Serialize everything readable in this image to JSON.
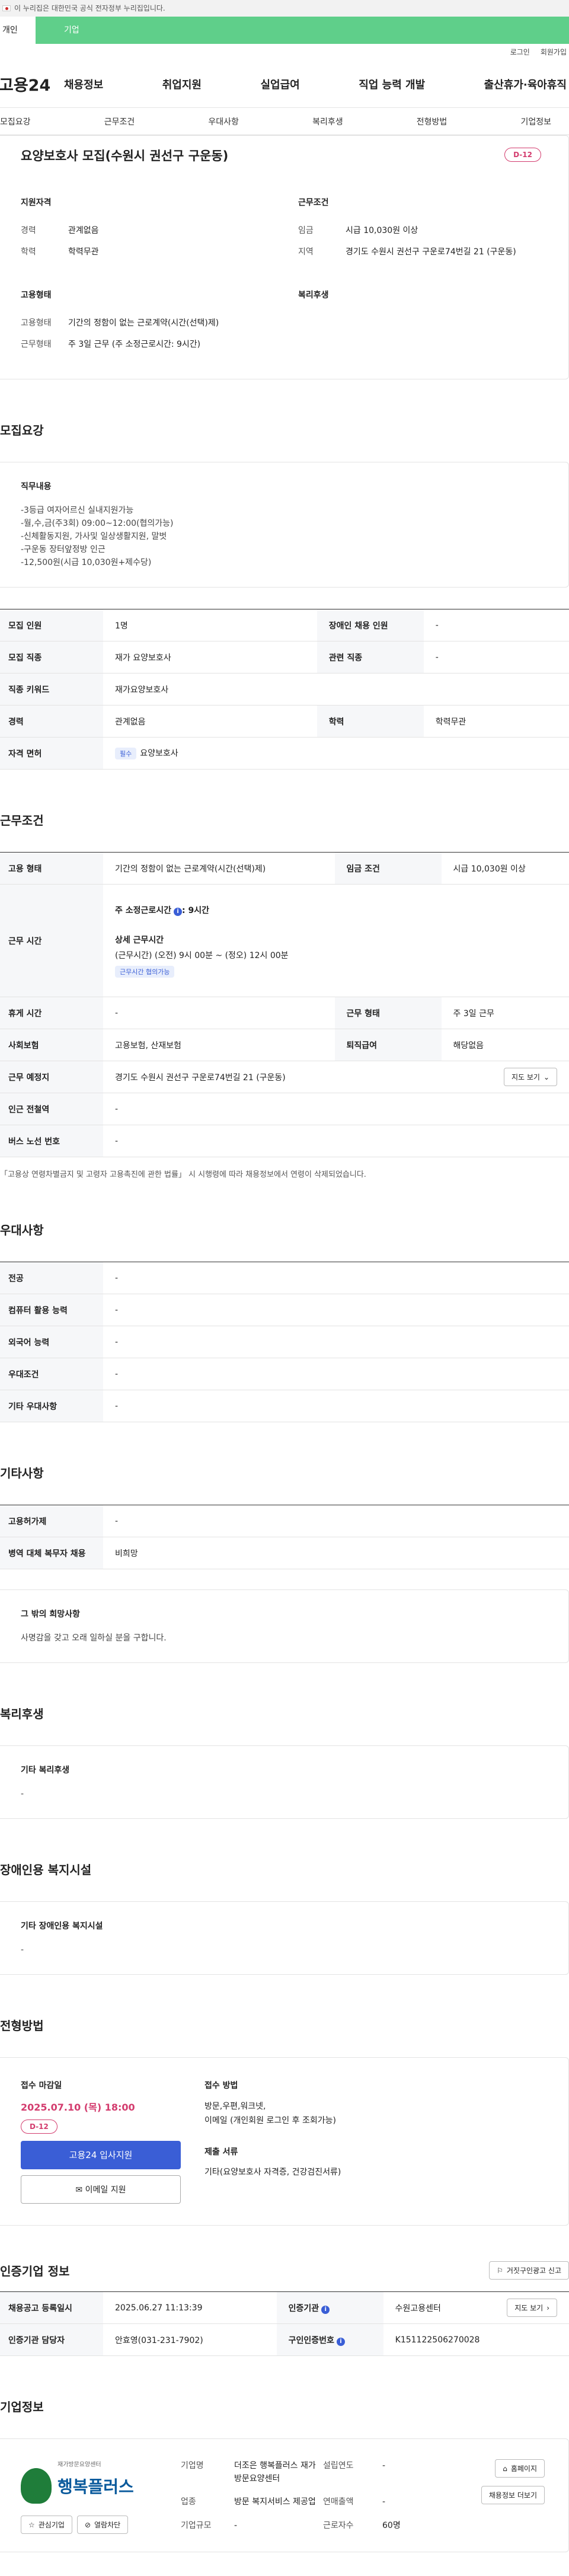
{
  "banner": {
    "text": "이 누리집은 대한민국 공식 전자정부 누리집입니다."
  },
  "user_tabs": [
    "개인",
    "기업"
  ],
  "util": [
    "로그인",
    "회원가입"
  ],
  "gnb": {
    "logo": "고용24",
    "items": [
      "채용정보",
      "취업지원",
      "실업급여",
      "직업 능력 개발",
      "출산휴가·육아휴직"
    ]
  },
  "tabs": [
    "모집요강",
    "근무조건",
    "우대사항",
    "복리후생",
    "전형방법",
    "기업정보"
  ],
  "summary": {
    "title": "요양보호사 모집(수원시 권선구 구운동)",
    "dday": "D-12",
    "qual_title": "지원자격",
    "career_k": "경력",
    "career_v": "관계없음",
    "edu_k": "학력",
    "edu_v": "학력무관",
    "cond_title": "근무조건",
    "wage_k": "임금",
    "wage_v": "시급 10,030원 이상",
    "area_k": "지역",
    "area_v": "경기도 수원시 권선구 구운로74번길 21 (구운동)",
    "emp_title": "고용형태",
    "emptype_k": "고용형태",
    "emptype_v": "기간의 정함이 없는 근로계약(시간(선택)제)",
    "worktype_k": "근무형태",
    "worktype_v": "주 3일 근무 (주 소정근로시간: 9시간)",
    "welfare_title": "복리후생"
  },
  "recruit": {
    "title": "모집요강",
    "duty_title": "직무내용",
    "duty": "-3등급 여자어르신 실내지원가능\n-월,수,금(주3회) 09:00~12:00(협의가능)\n-신체활동지원, 가사및 일상생활지원, 말벗\n-구운동 장터앞정방 인근\n-12,500원(시급 10,030원+제수당)",
    "rows": [
      {
        "k1": "모집 인원",
        "v1": "1명",
        "k2": "장애인 채용 인원",
        "v2": "-"
      },
      {
        "k1": "모집 직종",
        "v1": "재가 요양보호사",
        "k2": "관련 직종",
        "v2": "-"
      },
      {
        "k1": "직종 키워드",
        "v1": "재가요양보호사"
      },
      {
        "k1": "경력",
        "v1": "관계없음",
        "k2": "학력",
        "v2": "학력무관"
      },
      {
        "k1": "자격 면허",
        "badge": "필수",
        "v1": "요양보호사"
      }
    ]
  },
  "work": {
    "title": "근무조건",
    "r1": {
      "k1": "고용 형태",
      "v1": "기간의 정함이 없는 근로계약(시간(선택)제)",
      "k2": "임금 조건",
      "v2": "시급 10,030원 이상"
    },
    "hours": {
      "k": "근무 시간",
      "weekly": "주 소정근로시간",
      "weekly_v": ": 9시간",
      "detail_title": "상세 근무시간",
      "detail": "(근무시간) (오전) 9시 00분 ~ (정오) 12시 00분",
      "badge": "근무시간 협의가능"
    },
    "r2": {
      "k1": "휴게 시간",
      "v1": "-",
      "k2": "근무 형태",
      "v2": "주 3일 근무"
    },
    "r3": {
      "k1": "사회보험",
      "v1": "고용보험, 산재보험",
      "k2": "퇴직급여",
      "v2": "해당없음"
    },
    "r4": {
      "k1": "근무 예정지",
      "v1": "경기도 수원시 권선구 구운로74번길 21 (구운동)",
      "btn": "지도 보기"
    },
    "r5": {
      "k1": "인근 전철역",
      "v1": "-"
    },
    "r6": {
      "k1": "버스 노선 번호",
      "v1": "-"
    },
    "note": "「고용상 연령차별금지 및 고령자 고용촉진에 관한 법률」 시 시행령에 따라 채용정보에서 연령이 삭제되었습니다."
  },
  "pref": {
    "title": "우대사항",
    "rows": [
      {
        "k": "전공",
        "v": "-"
      },
      {
        "k": "컴퓨터 활용 능력",
        "v": "-"
      },
      {
        "k": "외국어 능력",
        "v": "-"
      },
      {
        "k": "우대조건",
        "v": "-"
      },
      {
        "k": "기타 우대사항",
        "v": "-"
      }
    ]
  },
  "etc": {
    "title": "기타사항",
    "rows": [
      {
        "k": "고용허가제",
        "v": "-"
      },
      {
        "k": "병역 대체 복무자 채용",
        "v": "비희망"
      }
    ],
    "wish_title": "그 밖의 희망사항",
    "wish": "사명감을 갖고 오래 일하실 분을 구합니다."
  },
  "welfare": {
    "title": "복리후생",
    "box_title": "기타 복리후생",
    "v": "-"
  },
  "disab": {
    "title": "장애인용 복지시설",
    "box_title": "기타 장애인용 복지시설",
    "v": "-"
  },
  "selection": {
    "title": "전형방법",
    "deadline_title": "접수 마감일",
    "deadline": "2025.07.10 (목) 18:00",
    "dday": "D-12",
    "apply_btn": "고용24 입사지원",
    "email_btn": "이메일 지원",
    "method_title": "접수 방법",
    "method": "방문,우편,워크넷,\n이메일 (개인회원 로그인 후 조회가능)",
    "docs_title": "제출 서류",
    "docs": "기타(요양보호사 자격증, 건강검진서류)"
  },
  "cert": {
    "title": "인증기업 정보",
    "report_btn": "거짓구인광고 신고",
    "r1": {
      "k1": "채용공고 등록일시",
      "v1": "2025.06.27 11:13:39",
      "k2": "인증기관",
      "v2": "수원고용센터",
      "btn": "지도 보기"
    },
    "r2": {
      "k1": "인증기관 담당자",
      "v1": "안효영(031-231-7902)",
      "k2": "구인인증번호",
      "v2": "K151122506270028"
    }
  },
  "company": {
    "title": "기업정보",
    "logo_small": "재가방문요양센터",
    "logo": "행복플러스",
    "fav_btn": "관심기업",
    "block_btn": "열람차단",
    "name_k": "기업명",
    "name_v": "더조은 행복플러스 재가방문요양센터",
    "ind_k": "업종",
    "ind_v": "방문 복지서비스 제공업",
    "size_k": "기업규모",
    "size_v": "-",
    "est_k": "설립연도",
    "est_v": "-",
    "sales_k": "연매출액",
    "sales_v": "-",
    "emp_k": "근로자수",
    "emp_v": "60명",
    "home_btn": "홈페이지",
    "more_btn": "채용정보 더보기"
  }
}
